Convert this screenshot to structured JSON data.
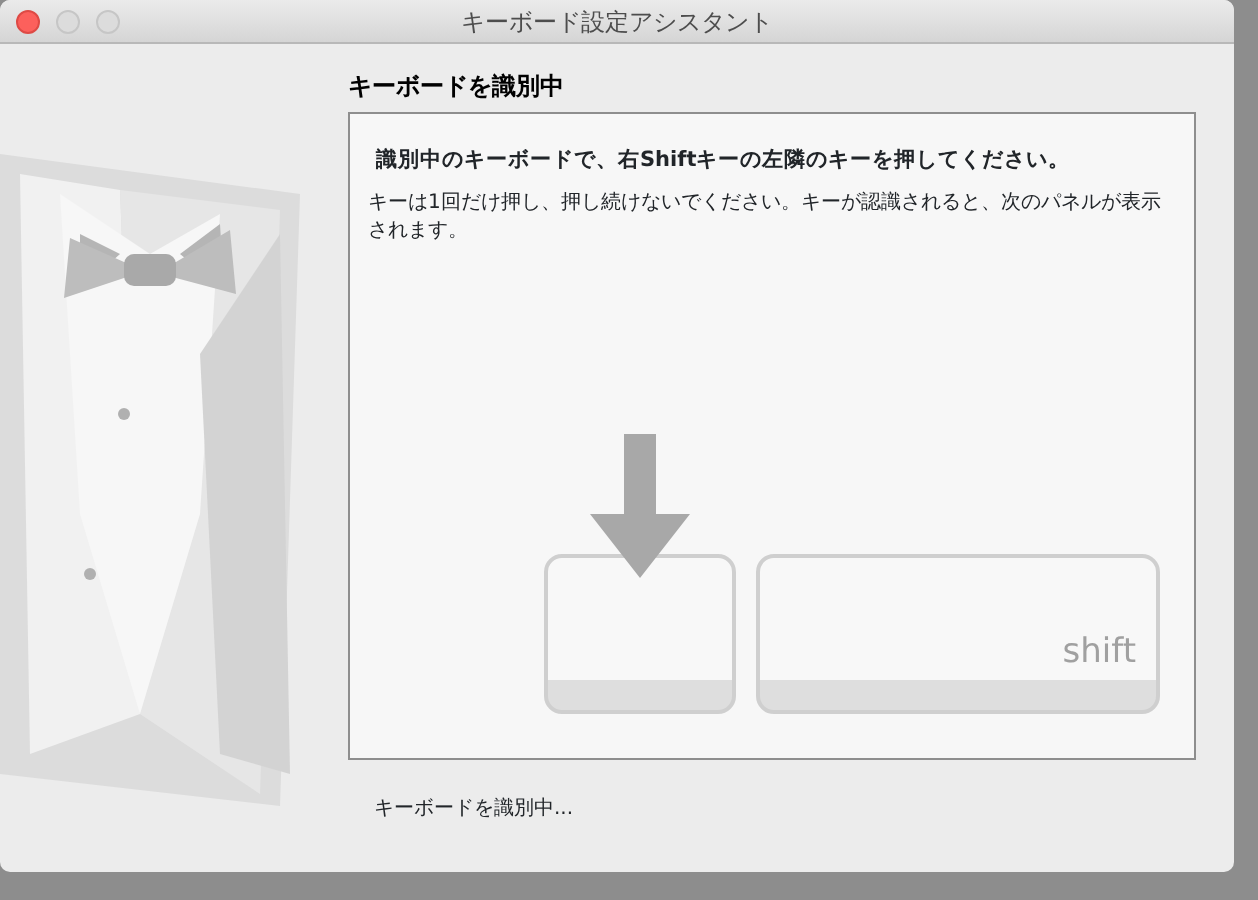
{
  "window": {
    "title": "キーボード設定アシスタント"
  },
  "heading": "キーボードを識別中",
  "panel": {
    "instruction": "識別中のキーボードで、右Shiftキーの左隣のキーを押してください。",
    "note": "キーは1回だけ押し、押し続けないでください。キーが認識されると、次のパネルが表示されます。",
    "keys": [
      {
        "selected": true
      },
      {
        "label": "shift",
        "selected": false
      }
    ]
  },
  "status": "キーボードを識別中..."
}
